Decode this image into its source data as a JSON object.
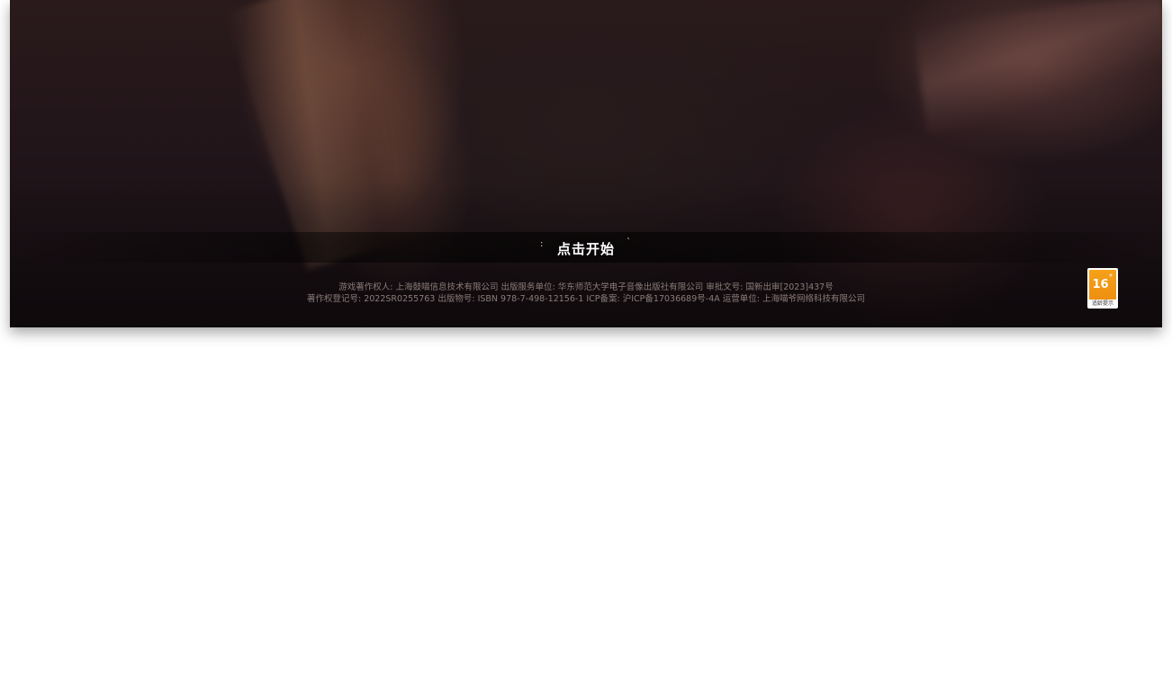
{
  "start_button": {
    "label": "点击开始"
  },
  "decor": {
    "left_mark": ":",
    "right_mark": "`"
  },
  "legal": {
    "line1": "游戏著作权人: 上海鼓喵信息技术有限公司  出版服务单位: 华东师范大学电子音像出版社有限公司  审批文号: 国新出审[2023]437号",
    "line2": "著作权登记号: 2022SR0255763 出版物号: ISBN 978-7-498-12156-1 ICP备案: 沪ICP备17036689号-4A 运营单位: 上海喵爷网络科技有限公司"
  },
  "age_rating": {
    "age": "16",
    "suffix": "+",
    "caption": "适龄提示",
    "color": "#f29a16"
  }
}
